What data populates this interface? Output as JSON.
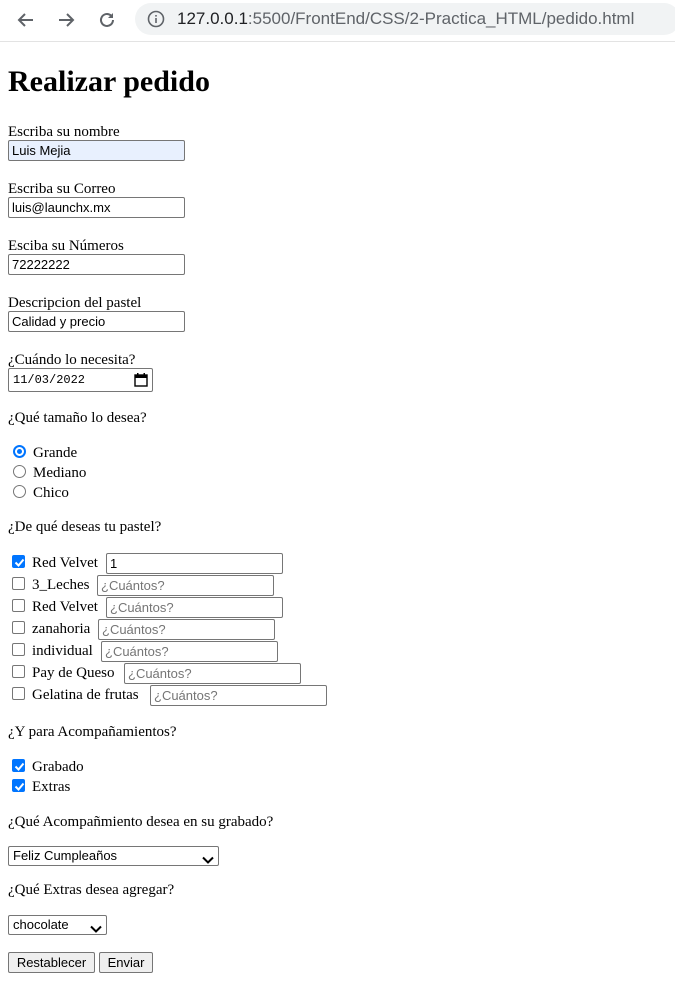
{
  "browser": {
    "url_host": "127.0.0.1",
    "url_path": ":5500/FrontEnd/CSS/2-Practica_HTML/pedido.html"
  },
  "page": {
    "title": "Realizar pedido",
    "nombre": {
      "label": "Escriba su nombre",
      "value": "Luis Mejia"
    },
    "correo": {
      "label": "Escriba su Correo",
      "value": "luis@launchx.mx"
    },
    "numeros": {
      "label": "Esciba su Números",
      "value": "72222222"
    },
    "descripcion": {
      "label": "Descripcion del pastel",
      "value": "Calidad y precio"
    },
    "fecha": {
      "label": "¿Cuándo lo necesita?",
      "value": "11/03/2022"
    },
    "tamano": {
      "question": "¿Qué tamaño lo desea?",
      "options": [
        {
          "label": "Grande",
          "checked": true
        },
        {
          "label": "Mediano",
          "checked": false
        },
        {
          "label": "Chico",
          "checked": false
        }
      ]
    },
    "sabores": {
      "question": "¿De qué deseas tu pastel?",
      "placeholder": "¿Cuántos?",
      "items": [
        {
          "label": "Red Velvet",
          "checked": true,
          "value": "1"
        },
        {
          "label": "3_Leches",
          "checked": false,
          "value": ""
        },
        {
          "label": "Red Velvet",
          "checked": false,
          "value": ""
        },
        {
          "label": "zanahoria",
          "checked": false,
          "value": ""
        },
        {
          "label": "individual",
          "checked": false,
          "value": ""
        },
        {
          "label": "Pay de Queso",
          "checked": false,
          "value": ""
        },
        {
          "label": "Gelatina de frutas",
          "checked": false,
          "value": ""
        }
      ]
    },
    "acompanamientos": {
      "question": "¿Y para Acompañamientos?",
      "items": [
        {
          "label": "Grabado",
          "checked": true
        },
        {
          "label": "Extras",
          "checked": true
        }
      ]
    },
    "grabado": {
      "question": "¿Qué Acompañmiento desea en su grabado?",
      "selected": "Feliz Cumpleaños"
    },
    "extras": {
      "question": "¿Qué Extras desea agregar?",
      "selected": "chocolate"
    },
    "buttons": {
      "reset": "Restablecer",
      "submit": "Enviar"
    }
  },
  "colors": {
    "accent": "#0075ff",
    "autofill": "#e8f0fe"
  }
}
